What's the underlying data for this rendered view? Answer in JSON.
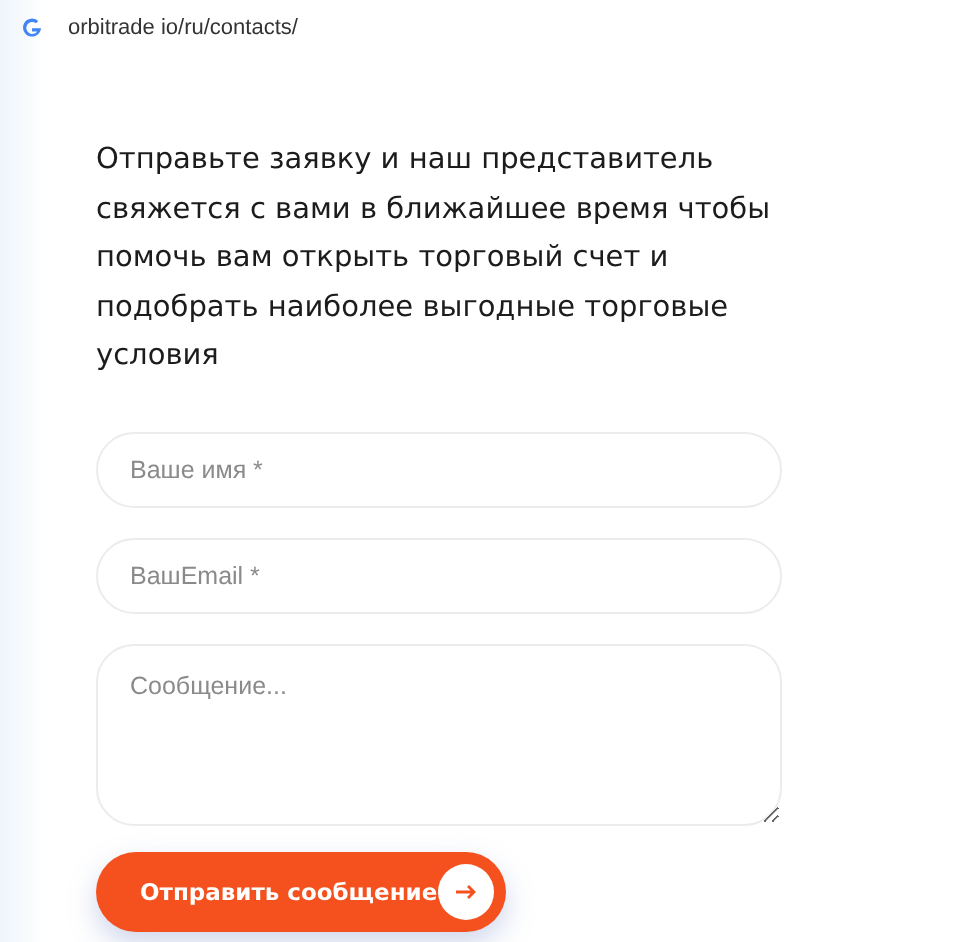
{
  "address_bar": {
    "url": "orbitrade io/ru/contacts/"
  },
  "intro": "Отправьте заявку и наш представитель\nсвяжется с вами в ближайшее время чтобы\nпомочь вам открыть торговый счет и\nподобрать наиболее выгодные торговые\nусловия",
  "form": {
    "name": {
      "placeholder": "Ваше имя *"
    },
    "email": {
      "placeholder": "ВашEmail *"
    },
    "message": {
      "placeholder": "Сообщение..."
    },
    "submit": {
      "label": "Отправить сообщение"
    }
  }
}
